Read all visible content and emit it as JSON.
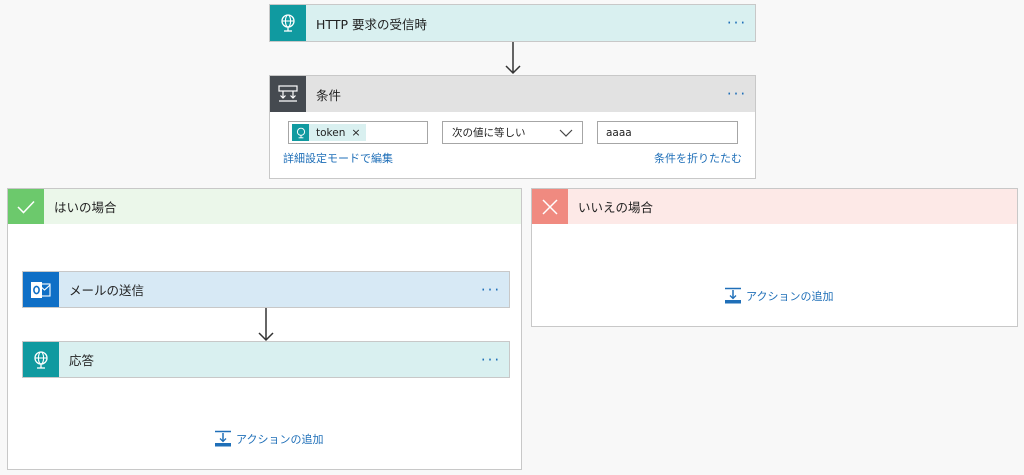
{
  "trigger": {
    "title": "HTTP 要求の受信時",
    "icon": "globe-icon"
  },
  "condition": {
    "title": "条件",
    "token_label": "token",
    "token_remove": "×",
    "operator": "次の値に等しい",
    "value": "aaaa",
    "advanced_link": "詳細設定モードで編集",
    "collapse_link": "条件を折りたたむ"
  },
  "yes_branch": {
    "title": "はいの場合",
    "actions": [
      {
        "title": "メールの送信",
        "icon": "outlook-icon"
      },
      {
        "title": "応答",
        "icon": "globe-icon"
      }
    ],
    "add_action": "アクションの追加"
  },
  "no_branch": {
    "title": "いいえの場合",
    "add_action": "アクションの追加"
  },
  "more_label": "···",
  "colors": {
    "teal": "#109aa0",
    "teal_light": "#d9f0f0",
    "outlook_blue": "#0f6fc6",
    "mail_light": "#d7e9f5",
    "condition_dark": "#454a50",
    "condition_header": "#e2e2e2",
    "yes_green": "#6cc96c",
    "yes_light": "#ebf7ea",
    "no_red": "#f08a80",
    "no_light": "#fde9e7",
    "link_blue": "#1f6fb8"
  }
}
